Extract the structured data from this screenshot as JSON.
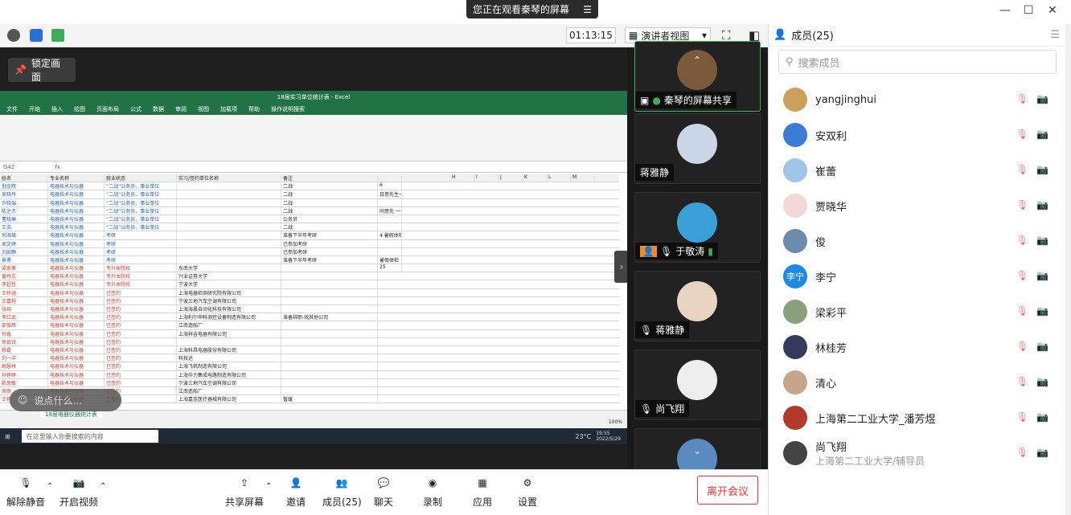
{
  "banner": {
    "text": "您正在观看秦琴的屏幕"
  },
  "toolbar": {
    "timer": "01:13:15",
    "view_label": "演讲者视图"
  },
  "stage": {
    "lock_label": "锁定画面",
    "comment_placeholder": "说点什么..."
  },
  "excel": {
    "title": "18届实习单位统计表 - Excel",
    "tabs": [
      "文件",
      "开始",
      "插入",
      "绘图",
      "页面布局",
      "公式",
      "数据",
      "审阅",
      "视图",
      "加载项",
      "帮助",
      "操作说明搜索"
    ],
    "cellref": "G42",
    "headers": [
      "姓名",
      "专业名称",
      "就业状态",
      "实习/签约单位名称",
      "备注",
      "",
      "",
      "H",
      "I",
      "J",
      "K",
      "L",
      "M"
    ],
    "rows": [
      [
        "倪金辉",
        "电器技术与仪器",
        "“二战”公务员、事业单位",
        "",
        "二战",
        "6"
      ],
      [
        "吴晓丹",
        "电器技术与仪器",
        "“二战”公务员、事业单位",
        "",
        "二战",
        "日意先生一个"
      ],
      [
        "许晓瑞",
        "电器技术与仪器",
        "“二战”公务员、事业单位",
        "",
        "二战",
        ""
      ],
      [
        "陈之杰",
        "电器技术与仪器",
        "“二战”公务员、事业单位",
        "",
        "二战",
        "同意先 一个"
      ],
      [
        "董晓琳",
        "电器技术与仪器",
        "“二战”公务员、事业单位",
        "",
        "公务员",
        ""
      ],
      [
        "王浩",
        "电器技术与仪器",
        "“二战”公务员、事业单位",
        "",
        "二战",
        ""
      ],
      [
        "何海斌",
        "电器技术与仪器",
        "考研",
        "",
        "准备下半年考研",
        "4 暑假体检"
      ],
      [
        "周文婷",
        "电器技术与仪器",
        "考研",
        "",
        "已参加考研",
        ""
      ],
      [
        "刘如静",
        "电器技术与仪器",
        "考研",
        "",
        "已参加考研",
        ""
      ],
      [
        "景勇",
        "电器技术与仪器",
        "考研",
        "",
        "准备下半年考研",
        "暑假体检"
      ],
      [
        "梁家豪",
        "电器技术与仪器",
        "专升本院校",
        "东南大学",
        "",
        "25"
      ],
      [
        "童丹志",
        "电器技术与仪器",
        "专升本院校",
        "兴业证券大学",
        ""
      ],
      [
        "李超哲",
        "电器技术与仪器",
        "专升本院校",
        "宁波大学",
        ""
      ],
      [
        "王梓涵",
        "电器技术与仪器",
        "已签约",
        "上海电器检测研究院有限公司",
        ""
      ],
      [
        "王嘉程",
        "电器技术与仪器",
        "已签约",
        "宁波三地汽车空调有限公司",
        ""
      ],
      [
        "张琦",
        "电器技术与仪器",
        "已签约",
        "上海海晨自动化科技有限公司",
        ""
      ],
      [
        "李红武",
        "电器技术与仪器",
        "已签约",
        "上海利尔申科测控设备制造有限公司",
        "准备辞职-找其他公司"
      ],
      [
        "邵俊辉",
        "电器技术与仪器",
        "已签约",
        "江南造船厂",
        ""
      ],
      [
        "孙鑫",
        "电器技术与仪器",
        "已签约",
        "上海祥吉电器有限公司",
        ""
      ],
      [
        "徐如诗",
        "电器技术与仪器",
        "已签约",
        "",
        ""
      ],
      [
        "杨磊",
        "电器技术与仪器",
        "已签约",
        "上海科昌电器股份有限公司",
        ""
      ],
      [
        "刘一洋",
        "电器技术与仪器",
        "已签约",
        "科技达",
        ""
      ],
      [
        "胡慧林",
        "电器技术与仪器",
        "已签约",
        "上海飞机制造有限公司",
        ""
      ],
      [
        "孙婷婷",
        "电器技术与仪器",
        "已签约",
        "上海华力集成电路制造有限公司",
        ""
      ],
      [
        "陈思敏",
        "电器技术与仪器",
        "已签约",
        "宁波三地汽车空调有限公司",
        ""
      ],
      [
        "周丽",
        "电器技术与仪器",
        "已签约",
        "江南造船厂",
        ""
      ],
      [
        "王艳",
        "电器技术与仪器",
        "已签约",
        "上海嘉信医疗器械有限公司",
        "暂缓"
      ]
    ],
    "sheet_tab": "18届电器仪器统计表",
    "zoom": "100%",
    "taskbar_search": "在这里输入你要搜索的内容",
    "clock_time": "19:55",
    "clock_date": "2022/5/29",
    "temp": "23°C"
  },
  "videos": [
    {
      "name": "秦琴的屏幕共享"
    },
    {
      "name": "蒋雅静"
    },
    {
      "name": "于敬涛"
    },
    {
      "name": "蒋雅静"
    },
    {
      "name": "尚飞翔"
    }
  ],
  "members": {
    "title": "成员(25)",
    "search_placeholder": "搜索成员",
    "list": [
      {
        "name": "yangjinghui",
        "sub": "",
        "color": "#c9a15a",
        "initial": ""
      },
      {
        "name": "安双利",
        "sub": "",
        "color": "#3a7bd5",
        "initial": ""
      },
      {
        "name": "崔蕾",
        "sub": "",
        "color": "#9fc5e8",
        "initial": ""
      },
      {
        "name": "贾晓华",
        "sub": "",
        "color": "#f6d7d7",
        "initial": ""
      },
      {
        "name": "俊",
        "sub": "",
        "color": "#6b8cae",
        "initial": ""
      },
      {
        "name": "李宁",
        "sub": "",
        "color": "#1e88e5",
        "initial": "李宁"
      },
      {
        "name": "梁彩平",
        "sub": "",
        "color": "#8aa07a",
        "initial": ""
      },
      {
        "name": "林桂芳",
        "sub": "",
        "color": "#333a5c",
        "initial": ""
      },
      {
        "name": "清心",
        "sub": "",
        "color": "#c7a58a",
        "initial": ""
      },
      {
        "name": "上海第二工业大学_潘芳煜",
        "sub": "",
        "color": "#b33a2a",
        "initial": ""
      },
      {
        "name": "尚飞翔",
        "sub": "上海第二工业大学/辅导员",
        "color": "#444",
        "initial": ""
      }
    ]
  },
  "bottom": {
    "mute": "解除静音",
    "video": "开启视频",
    "share": "共享屏幕",
    "invite": "邀请",
    "members": "成员(25)",
    "chat": "聊天",
    "record": "录制",
    "apps": "应用",
    "settings": "设置",
    "leave": "离开会议"
  }
}
